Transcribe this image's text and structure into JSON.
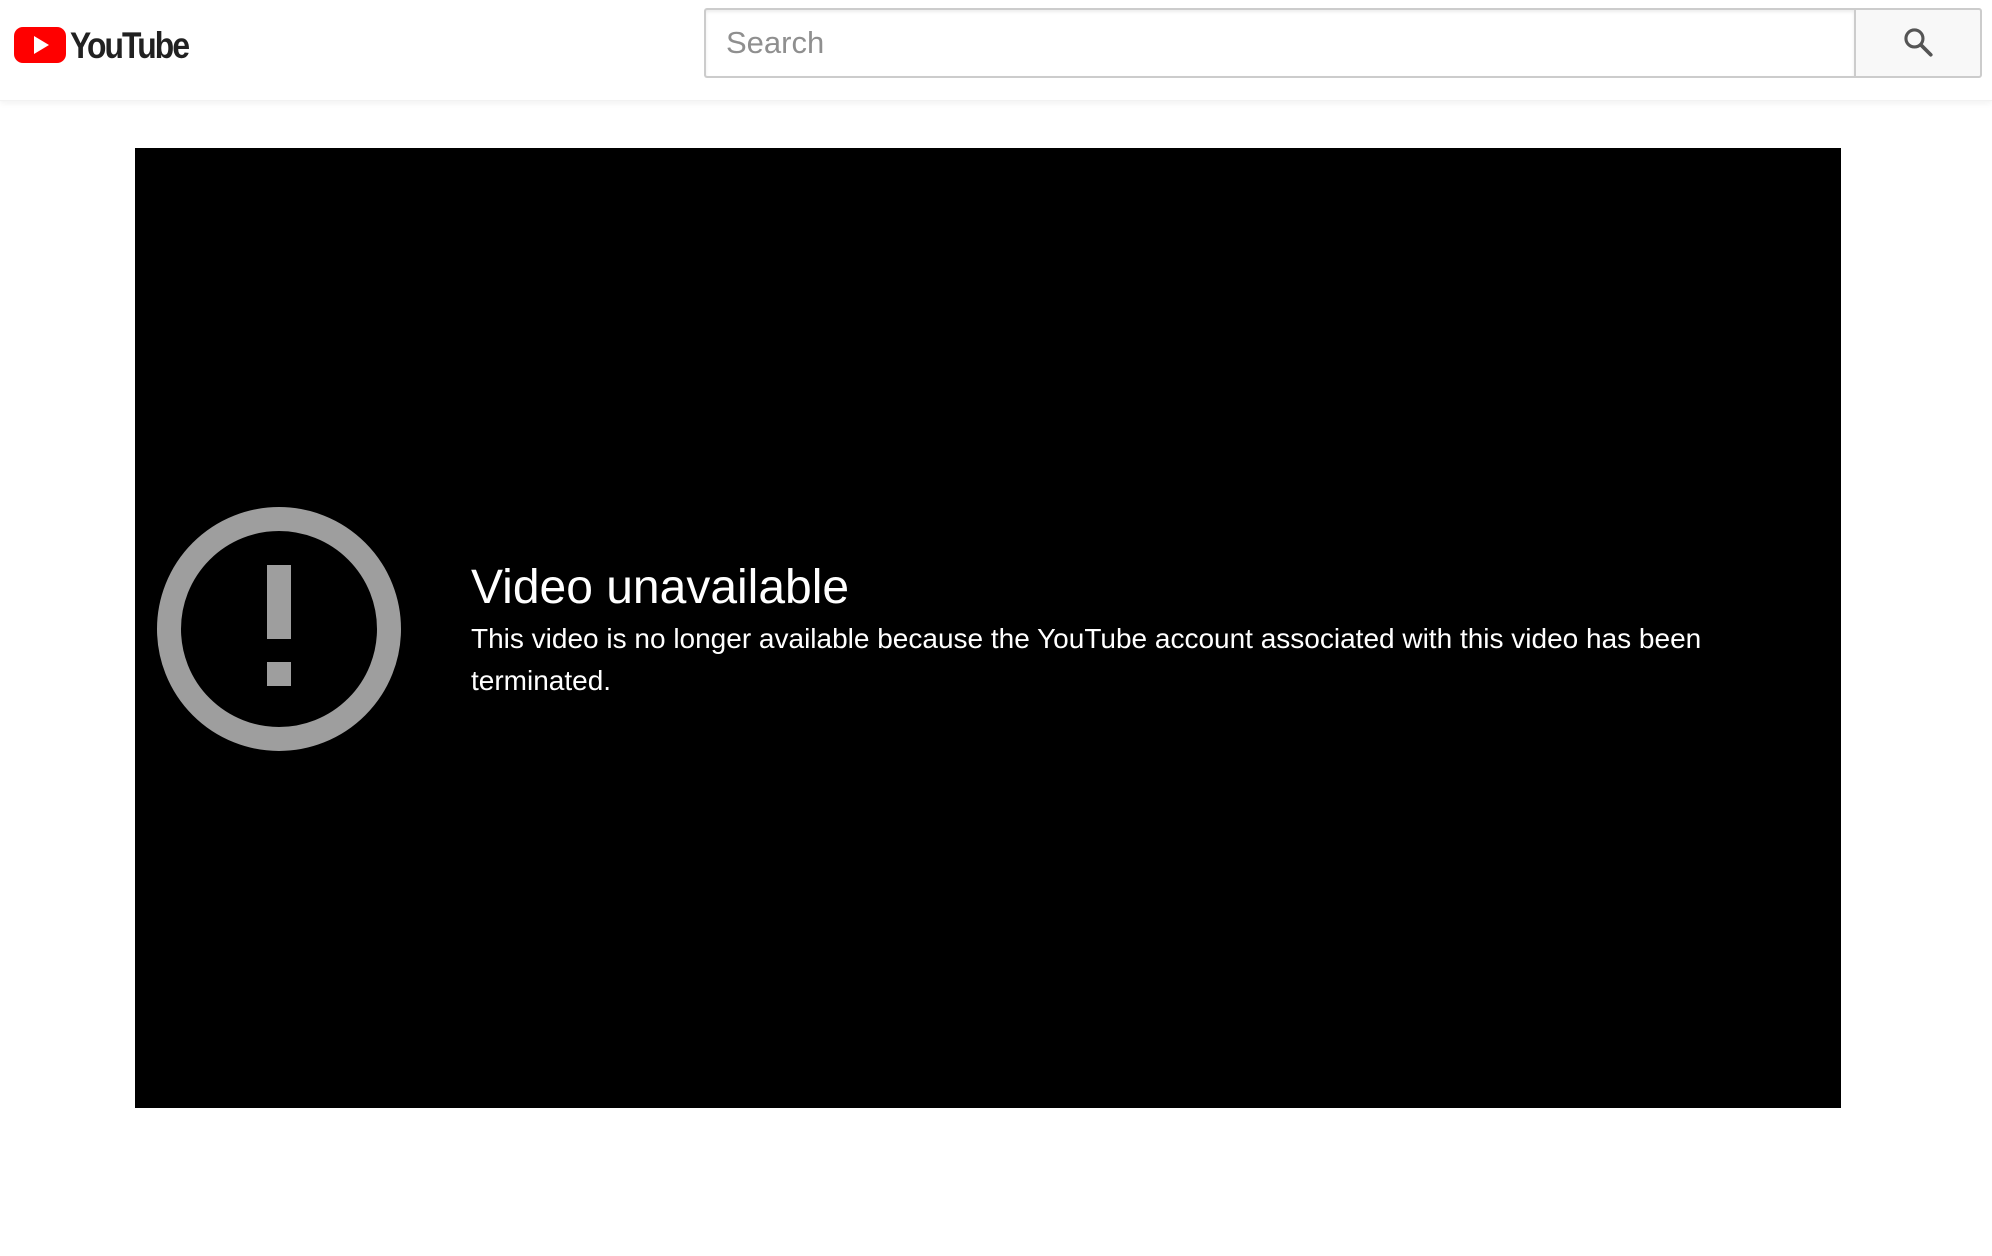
{
  "header": {
    "logo_text": "YouTube",
    "logo_icon": "youtube-play-icon",
    "search": {
      "placeholder": "Search",
      "value": "",
      "button_icon": "search-icon"
    }
  },
  "player": {
    "error_icon": "exclamation-circle-icon",
    "error_title": "Video unavailable",
    "error_message": "This video is no longer available because the YouTube account associated with this video has been terminated."
  },
  "colors": {
    "brand_red": "#ff0000",
    "player_background": "#000000",
    "error_icon_gray": "#9e9e9e",
    "text_white": "#ffffff",
    "logo_text": "#212121"
  }
}
